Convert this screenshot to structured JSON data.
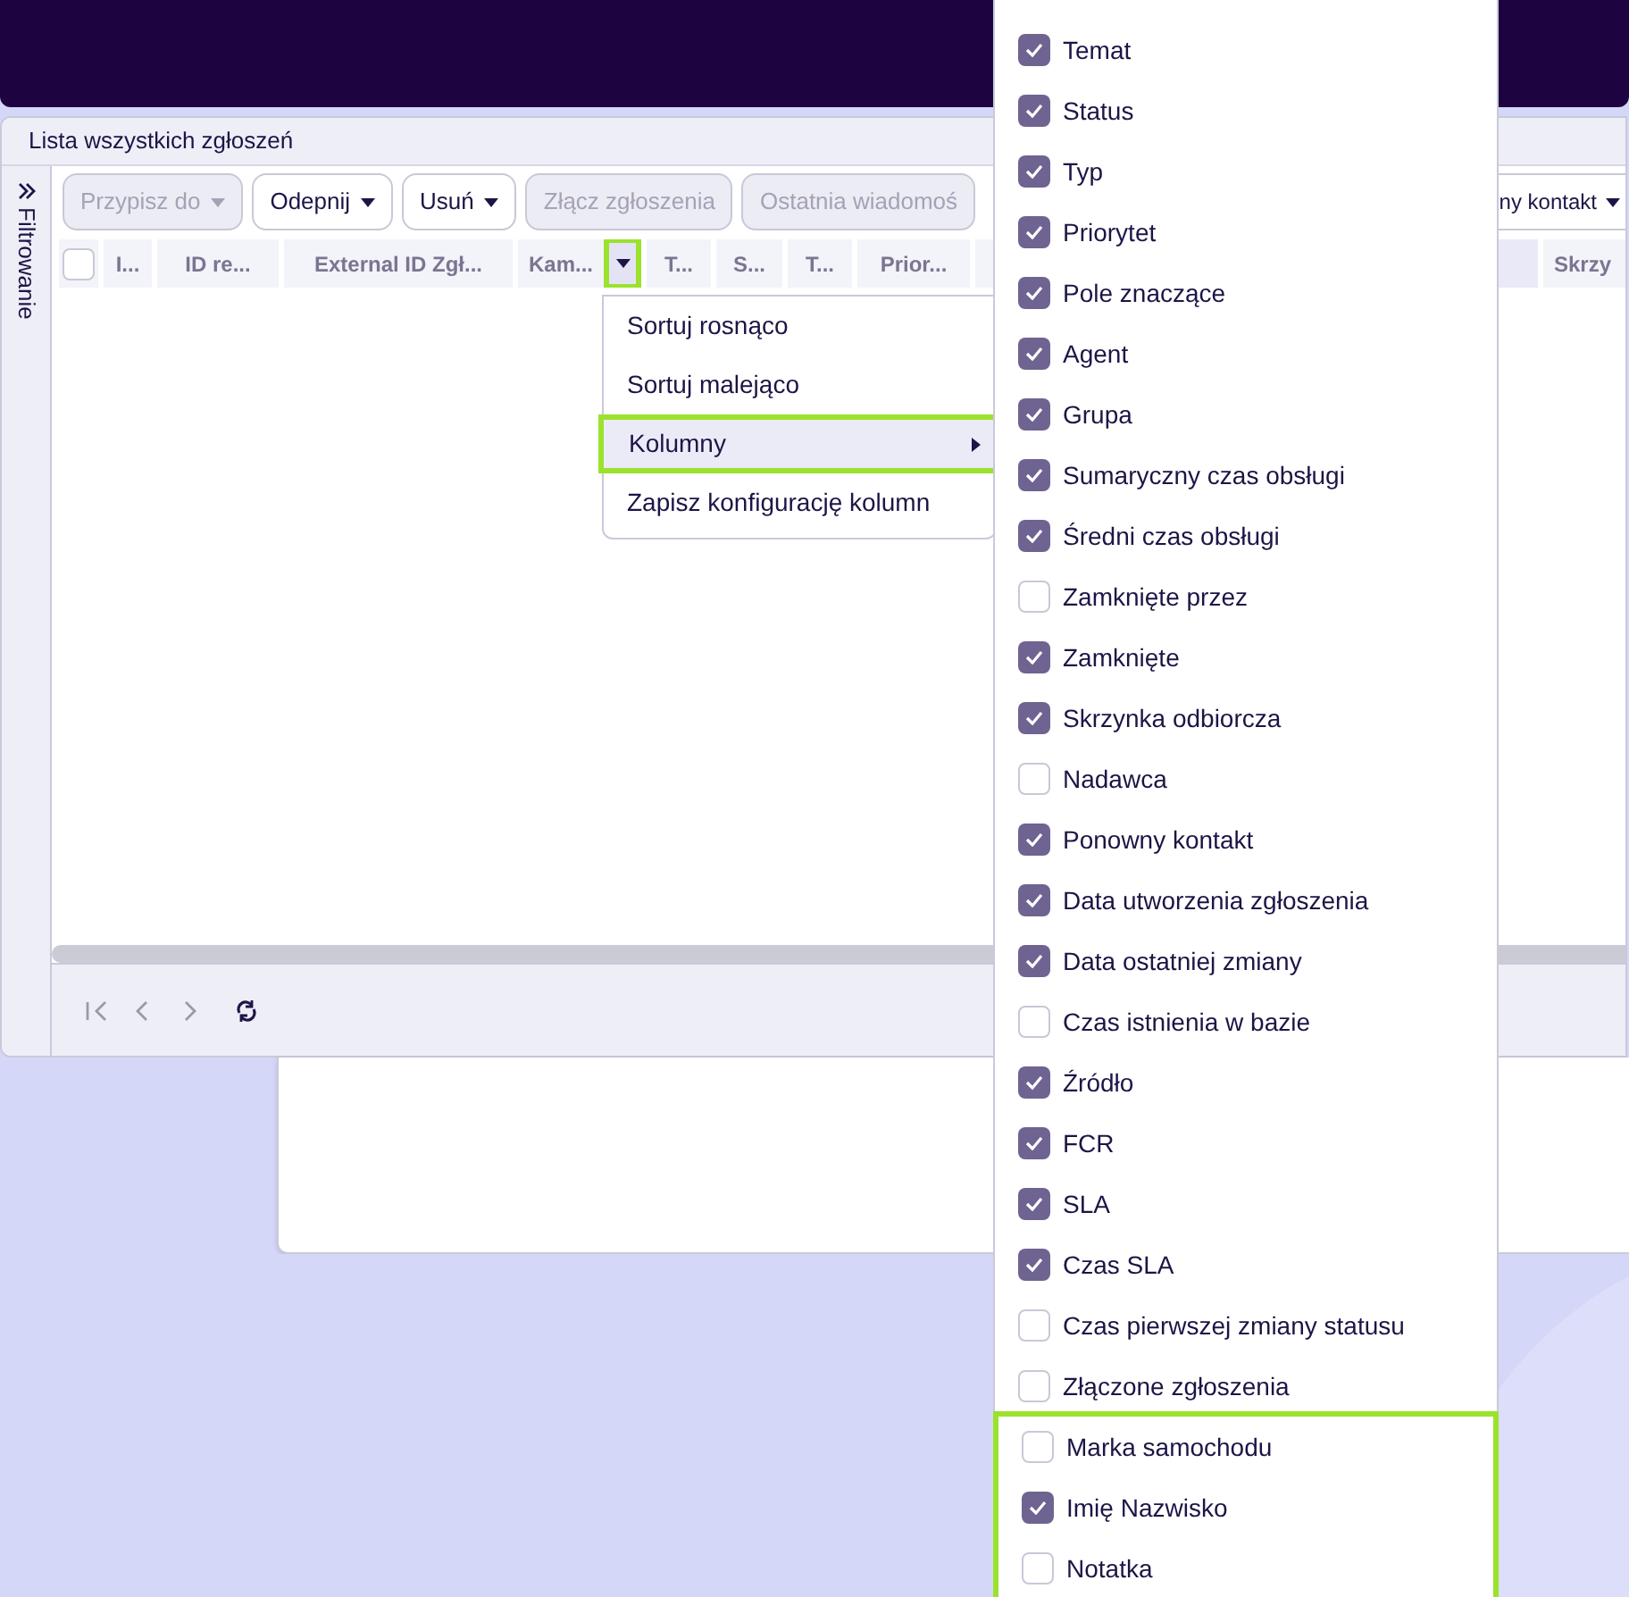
{
  "panel": {
    "title": "Lista wszystkich zgłoszeń"
  },
  "filter_sidebar": {
    "label": "Filtrowanie"
  },
  "toolbar": {
    "left": [
      {
        "label": "Przypisz do",
        "disabled": true,
        "dropdown": true
      },
      {
        "label": "Odepnij",
        "disabled": false,
        "dropdown": true
      },
      {
        "label": "Usuń",
        "disabled": false,
        "dropdown": true
      },
      {
        "label": "Złącz zgłoszenia",
        "disabled": true,
        "dropdown": false
      },
      {
        "label": "Ostatnia wiadomoś",
        "disabled": true,
        "dropdown": false
      }
    ],
    "right": [
      {
        "label": "ny kontakt",
        "disabled": false,
        "dropdown": true
      }
    ]
  },
  "table": {
    "select_all": {
      "checked": false
    },
    "columns": [
      {
        "label": "I..."
      },
      {
        "label": "ID re..."
      },
      {
        "label": "External ID Zgł..."
      },
      {
        "label": "Kam...",
        "menu_open": true
      },
      {
        "label": "T..."
      },
      {
        "label": "S..."
      },
      {
        "label": "T..."
      },
      {
        "label": "Prior..."
      }
    ],
    "right_columns": [
      {
        "label": "Skrzy"
      }
    ]
  },
  "column_menu": {
    "items": [
      {
        "label": "Sortuj rosnąco",
        "selected": false,
        "submenu": false
      },
      {
        "label": "Sortuj malejąco",
        "selected": false,
        "submenu": false
      },
      {
        "label": "Kolumny",
        "selected": true,
        "submenu": true
      },
      {
        "label": "Zapisz konfigurację kolumn",
        "selected": false,
        "submenu": false
      }
    ]
  },
  "columns_submenu": {
    "items": [
      {
        "label": "Temat",
        "checked": true,
        "highlighted": false
      },
      {
        "label": "Status",
        "checked": true,
        "highlighted": false
      },
      {
        "label": "Typ",
        "checked": true,
        "highlighted": false
      },
      {
        "label": "Priorytet",
        "checked": true,
        "highlighted": false
      },
      {
        "label": "Pole znaczące",
        "checked": true,
        "highlighted": false
      },
      {
        "label": "Agent",
        "checked": true,
        "highlighted": false
      },
      {
        "label": "Grupa",
        "checked": true,
        "highlighted": false
      },
      {
        "label": "Sumaryczny czas obsługi",
        "checked": true,
        "highlighted": false
      },
      {
        "label": "Średni czas obsługi",
        "checked": true,
        "highlighted": false
      },
      {
        "label": "Zamknięte przez",
        "checked": false,
        "highlighted": false
      },
      {
        "label": "Zamknięte",
        "checked": true,
        "highlighted": false
      },
      {
        "label": "Skrzynka odbiorcza",
        "checked": true,
        "highlighted": false
      },
      {
        "label": "Nadawca",
        "checked": false,
        "highlighted": false
      },
      {
        "label": "Ponowny kontakt",
        "checked": true,
        "highlighted": false
      },
      {
        "label": "Data utworzenia zgłoszenia",
        "checked": true,
        "highlighted": false
      },
      {
        "label": "Data ostatniej zmiany",
        "checked": true,
        "highlighted": false
      },
      {
        "label": "Czas istnienia w bazie",
        "checked": false,
        "highlighted": false
      },
      {
        "label": "Źródło",
        "checked": true,
        "highlighted": false
      },
      {
        "label": "FCR",
        "checked": true,
        "highlighted": false
      },
      {
        "label": "SLA",
        "checked": true,
        "highlighted": false
      },
      {
        "label": "Czas SLA",
        "checked": true,
        "highlighted": false
      },
      {
        "label": "Czas pierwszej zmiany statusu",
        "checked": false,
        "highlighted": false
      },
      {
        "label": "Złączone zgłoszenia",
        "checked": false,
        "highlighted": false
      },
      {
        "label": "Marka samochodu",
        "checked": false,
        "highlighted": true
      },
      {
        "label": "Imię Nazwisko",
        "checked": true,
        "highlighted": true
      },
      {
        "label": "Notatka",
        "checked": false,
        "highlighted": true
      }
    ]
  },
  "pager": {
    "buttons": [
      {
        "kind": "first",
        "disabled": true
      },
      {
        "kind": "prev",
        "disabled": true
      },
      {
        "kind": "next",
        "disabled": true
      },
      {
        "kind": "refresh",
        "disabled": false
      }
    ]
  }
}
